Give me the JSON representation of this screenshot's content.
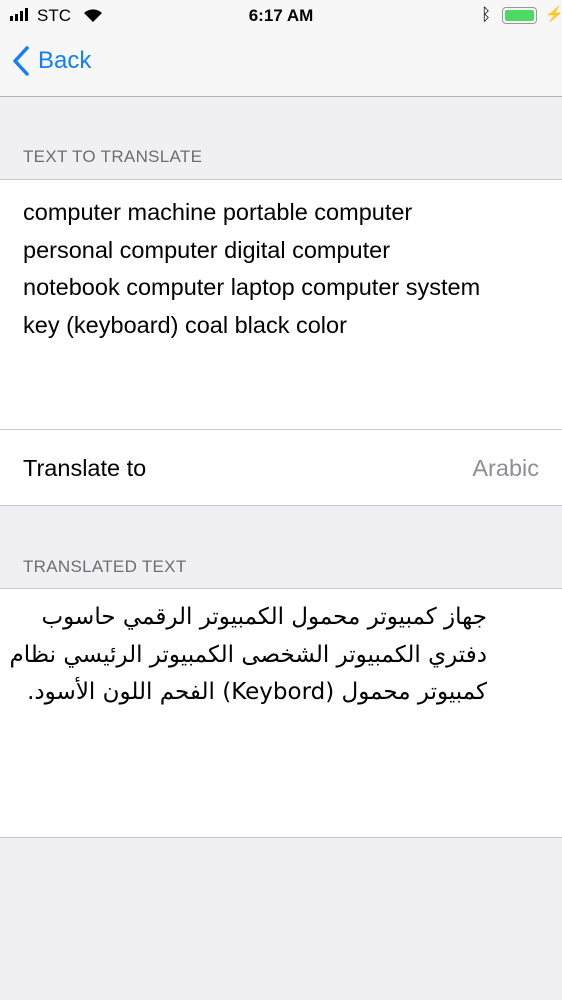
{
  "status": {
    "carrier": "STC",
    "time": "6:17 AM"
  },
  "nav": {
    "back_label": "Back"
  },
  "source": {
    "header": "TEXT TO TRANSLATE",
    "lines": [
      "computer machine portable computer",
      "personal computer digital computer",
      "notebook computer laptop computer system",
      "key (keyboard) coal black color"
    ]
  },
  "target": {
    "label": "Translate to",
    "value": "Arabic"
  },
  "result": {
    "header": "TRANSLATED TEXT",
    "lines": [
      "جهاز كمبيوتر محمول الكمبيوتر الرقمي حاسوب",
      "دفتري الكمبيوتر الشخصى الكمبيوتر الرئيسي نظام",
      "كمبيوتر محمول (Keybord) الفحم اللون الأسود."
    ]
  },
  "colors": {
    "accent": "#147efb",
    "battery": "#4cd964"
  }
}
